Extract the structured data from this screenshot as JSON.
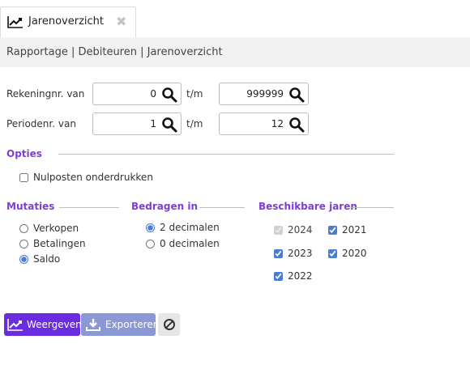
{
  "tab": {
    "label": "Jarenoverzicht",
    "close_glyph": "✖"
  },
  "breadcrumb": "Rapportage | Debiteuren | Jarenoverzicht",
  "filters": {
    "rekening": {
      "label": "Rekeningnr. van",
      "from": "0",
      "sep": "t/m",
      "to": "999999"
    },
    "periode": {
      "label": "Periodenr. van",
      "from": "1",
      "sep": "t/m",
      "to": "12"
    }
  },
  "opties": {
    "title": "Opties",
    "nulposten": "Nulposten onderdrukken"
  },
  "mutaties": {
    "title": "Mutaties",
    "options": [
      "Verkopen",
      "Betalingen",
      "Saldo"
    ],
    "selected": "Saldo"
  },
  "bedragen": {
    "title": "Bedragen in",
    "options": [
      "2 decimalen",
      "0 decimalen"
    ],
    "selected": "2 decimalen"
  },
  "jaren": {
    "title": "Beschikbare jaren",
    "years": [
      "2024",
      "2021",
      "2023",
      "2020",
      "2022"
    ]
  },
  "buttons": {
    "weergeven": "Weergeven",
    "exporteren": "Exporteren"
  },
  "colors": {
    "accent": "#7b3fd3",
    "primary_button": "#6a2ce0",
    "export_button": "#8a98d6"
  },
  "icons": {
    "tab": "chart-line-icon",
    "close": "close-icon",
    "search": "search-icon",
    "weergeven": "chart-line-icon",
    "exporteren": "download-icon",
    "cancel": "block-icon"
  }
}
